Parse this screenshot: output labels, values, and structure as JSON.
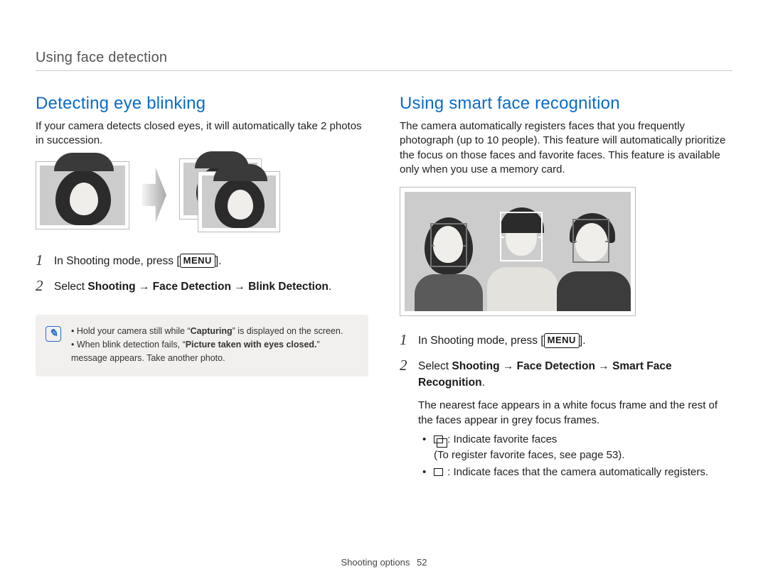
{
  "chapter_title": "Using face detection",
  "left": {
    "heading": "Detecting eye blinking",
    "intro": "If your camera detects closed eyes, it will automatically take 2 photos in succession.",
    "step1": "In Shooting mode, press [",
    "step1_suffix": "].",
    "menu_label": "MENU",
    "step2_prefix": "Select ",
    "step2_a": "Shooting",
    "step2_arrow": " → ",
    "step2_b": "Face Detection",
    "step2_c": "Blink Detection",
    "step2_suffix": ".",
    "info": {
      "line1_a": "Hold your camera still while “",
      "line1_b": "Capturing",
      "line1_c": "” is displayed on the screen.",
      "line2_a": "When blink detection fails, “",
      "line2_b": "Picture taken with eyes closed.",
      "line2_c": "” message appears. Take another photo."
    }
  },
  "right": {
    "heading": "Using smart face recognition",
    "intro": "The camera automatically registers faces that you frequently photograph (up to 10 people). This feature will automatically prioritize the focus on those faces and favorite faces. This feature is available only when you use a memory card.",
    "step1": "In Shooting mode, press [",
    "step1_suffix": "].",
    "menu_label": "MENU",
    "step2_prefix": "Select ",
    "step2_a": "Shooting",
    "step2_arrow": " → ",
    "step2_b": "Face Detection",
    "step2_c": "Smart Face Recognition",
    "step2_suffix": ".",
    "substep_text": "The nearest face appears in a white focus frame and the rest of the faces appear in grey focus frames.",
    "bullet1_a": " : Indicate favorite faces",
    "bullet1_b": "(To register favorite faces, see page 53).",
    "bullet2": " : Indicate faces that the camera automatically registers."
  },
  "footer": {
    "section": "Shooting options",
    "page": "52"
  }
}
